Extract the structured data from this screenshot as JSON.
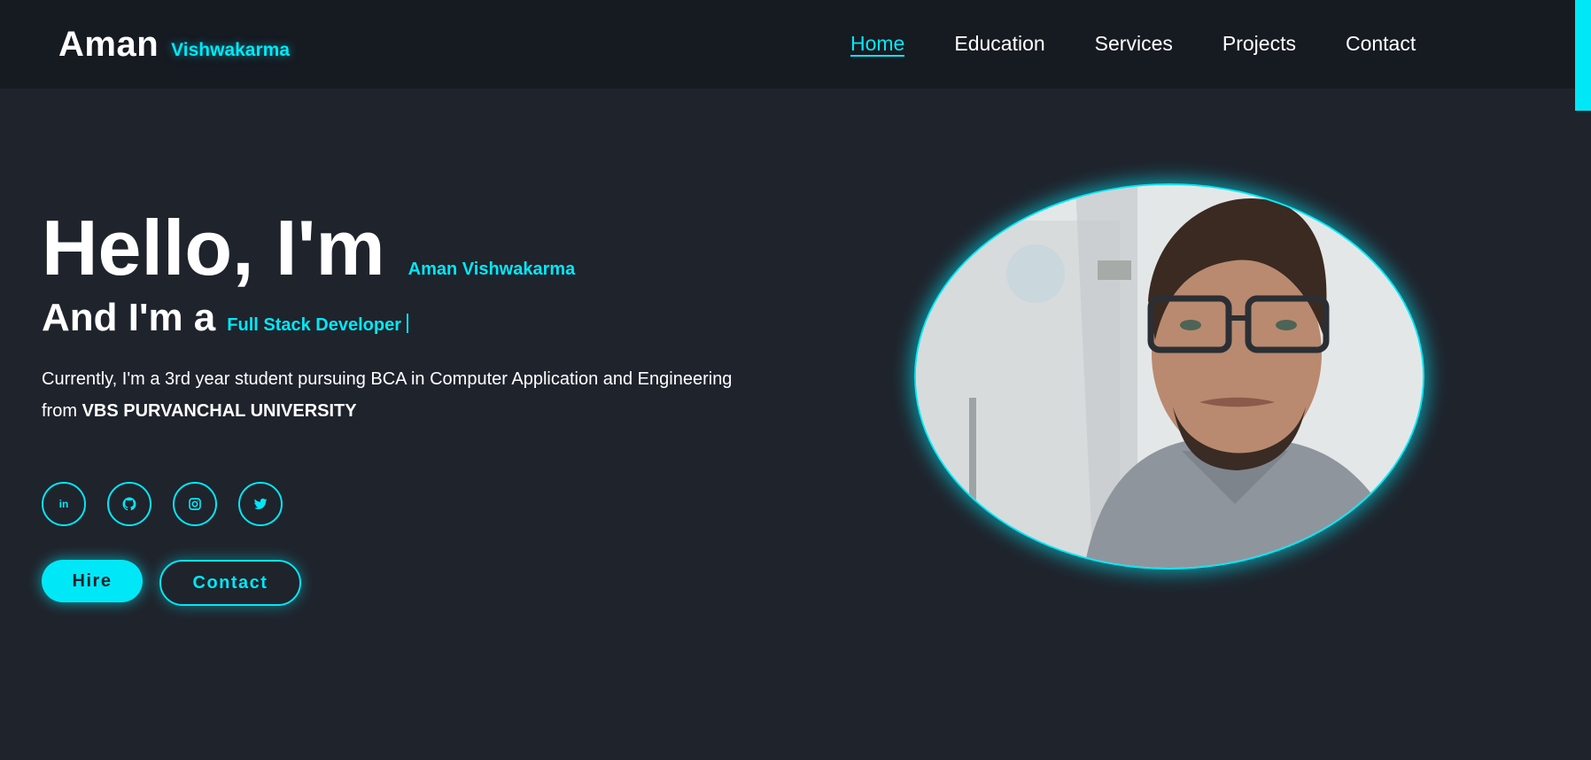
{
  "header": {
    "logo_main": "Aman",
    "logo_sub": "Vishwakarma",
    "nav": [
      {
        "label": "Home",
        "active": true
      },
      {
        "label": "Education",
        "active": false
      },
      {
        "label": "Services",
        "active": false
      },
      {
        "label": "Projects",
        "active": false
      },
      {
        "label": "Contact",
        "active": false
      }
    ]
  },
  "hero": {
    "greeting": "Hello, I'm",
    "name": "Aman Vishwakarma",
    "role_prefix": "And I'm a",
    "role": "Full Stack Developer",
    "description_line1": "Currently, I'm a 3rd year student pursuing BCA in Computer Application and Engineering",
    "description_from": "from",
    "university": "VBS PURVANCHAL UNIVERSITY",
    "socials": [
      {
        "icon": "linkedin-icon"
      },
      {
        "icon": "github-icon"
      },
      {
        "icon": "instagram-icon"
      },
      {
        "icon": "twitter-icon"
      }
    ],
    "hire_label": "Hire",
    "contact_label": "Contact"
  },
  "colors": {
    "accent": "#00e8f7",
    "background": "#1f232c",
    "header_background": "#161a21"
  }
}
